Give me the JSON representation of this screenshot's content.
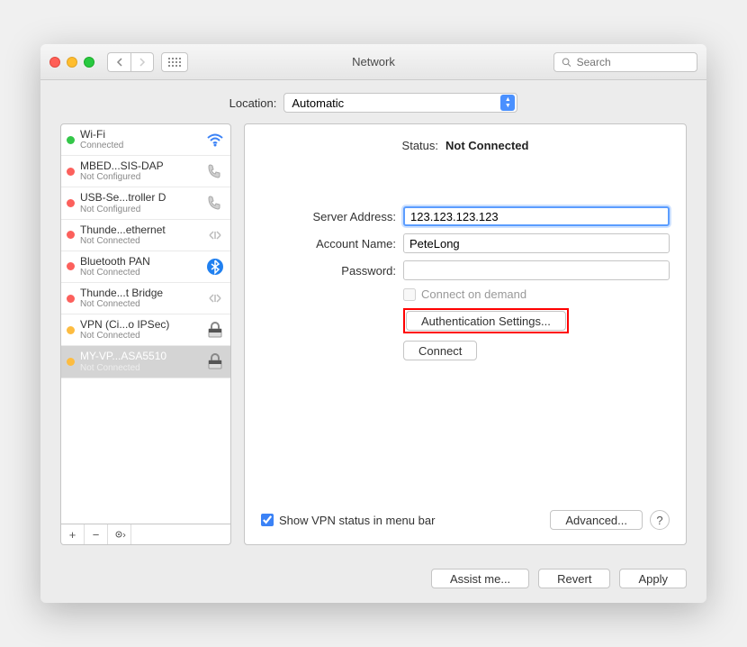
{
  "title": "Network",
  "search_placeholder": "Search",
  "location_label": "Location:",
  "location_value": "Automatic",
  "networks": [
    {
      "name": "Wi-Fi",
      "status": "Connected",
      "dot": "green",
      "icon": "wifi"
    },
    {
      "name": "MBED...SIS-DAP",
      "status": "Not Configured",
      "dot": "red",
      "icon": "phone"
    },
    {
      "name": "USB-Se...troller D",
      "status": "Not Configured",
      "dot": "red",
      "icon": "phone"
    },
    {
      "name": "Thunde...ethernet",
      "status": "Not Connected",
      "dot": "red",
      "icon": "ethernet"
    },
    {
      "name": "Bluetooth PAN",
      "status": "Not Connected",
      "dot": "red",
      "icon": "bluetooth"
    },
    {
      "name": "Thunde...t Bridge",
      "status": "Not Connected",
      "dot": "red",
      "icon": "ethernet"
    },
    {
      "name": "VPN (Ci...o IPSec)",
      "status": "Not Connected",
      "dot": "yellow",
      "icon": "vpn"
    },
    {
      "name": "MY-VP...ASA5510",
      "status": "Not Connected",
      "dot": "yellow",
      "icon": "vpn",
      "selected": true
    }
  ],
  "detail": {
    "status_label": "Status:",
    "status_value": "Not Connected",
    "server_label": "Server Address:",
    "server_value": "123.123.123.123",
    "account_label": "Account Name:",
    "account_value": "PeteLong",
    "password_label": "Password:",
    "password_value": "",
    "connect_demand": "Connect on demand",
    "auth_settings": "Authentication Settings...",
    "connect": "Connect",
    "show_vpn": "Show VPN status in menu bar",
    "advanced": "Advanced...",
    "help": "?"
  },
  "footer": {
    "assist": "Assist me...",
    "revert": "Revert",
    "apply": "Apply"
  }
}
